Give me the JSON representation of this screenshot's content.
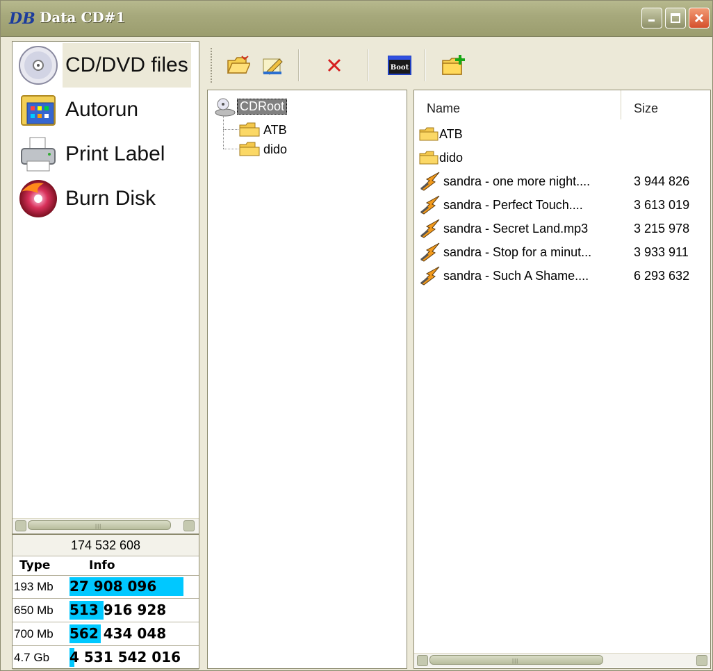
{
  "window": {
    "title": "Data CD#1",
    "app_icon_text": "DB"
  },
  "nav": {
    "items": [
      {
        "label": "CD/DVD files",
        "icon": "cd-disc-icon"
      },
      {
        "label": "Autorun",
        "icon": "autorun-folder-icon"
      },
      {
        "label": "Print Label",
        "icon": "printer-icon"
      },
      {
        "label": "Burn Disk",
        "icon": "burn-disc-icon"
      }
    ],
    "selected": 0
  },
  "info": {
    "total": "174 532 608",
    "headers": {
      "type": "Type",
      "info": "Info"
    },
    "rows": [
      {
        "type": "193 Mb",
        "value": "27 908 096",
        "fill": 0.91
      },
      {
        "type": "650 Mb",
        "value": "513 916 928",
        "fill": 0.27
      },
      {
        "type": "700 Mb",
        "value": "562 434 048",
        "fill": 0.25
      },
      {
        "type": "4.7 Gb",
        "value": "4 531 542 016",
        "fill": 0.04
      }
    ]
  },
  "toolbar": {
    "buttons": [
      "add-files-icon",
      "rename-icon",
      "delete-icon",
      "boot-icon",
      "new-folder-icon"
    ],
    "boot_label": "Boot"
  },
  "tree": {
    "root": "CDRoot",
    "children": [
      "ATB",
      "dido"
    ]
  },
  "list": {
    "columns": {
      "name": "Name",
      "size": "Size"
    },
    "items": [
      {
        "name": "ATB",
        "size": "",
        "type": "folder"
      },
      {
        "name": "dido",
        "size": "",
        "type": "folder"
      },
      {
        "name": "sandra - one more night....",
        "size": "3 944 826",
        "type": "audio"
      },
      {
        "name": "sandra - Perfect Touch....",
        "size": "3 613 019",
        "type": "audio"
      },
      {
        "name": "sandra - Secret Land.mp3",
        "size": "3 215 978",
        "type": "audio"
      },
      {
        "name": "sandra - Stop for a minut...",
        "size": "3 933 911",
        "type": "audio"
      },
      {
        "name": "sandra - Such A Shame....",
        "size": "6 293 632",
        "type": "audio"
      }
    ]
  }
}
